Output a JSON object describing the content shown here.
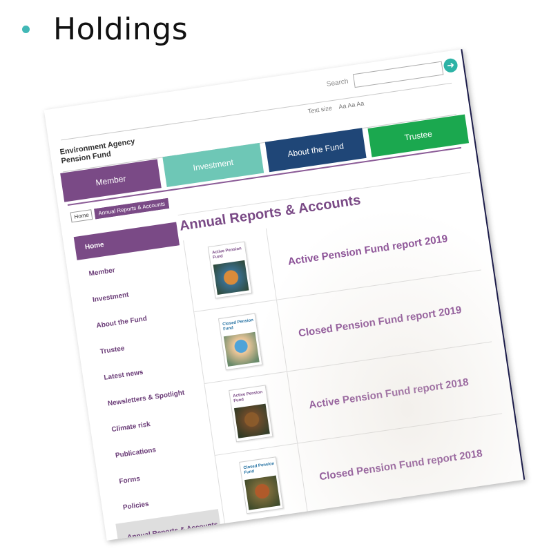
{
  "slide": {
    "title": "Holdings"
  },
  "header": {
    "org_line1": "Environment Agency",
    "org_line2": "Pension Fund",
    "text_size_label": "Text size",
    "text_size_options": "Aa Aa Aa",
    "search_label": "Search",
    "search_value": "",
    "search_go_icon": "➜"
  },
  "nav": {
    "tabs": [
      {
        "label": "Member"
      },
      {
        "label": "Investment"
      },
      {
        "label": "About the Fund"
      },
      {
        "label": "Trustee"
      }
    ]
  },
  "breadcrumb": {
    "home": "Home",
    "current": "Annual Reports & Accounts"
  },
  "sidebar": {
    "items": [
      {
        "label": "Home"
      },
      {
        "label": "Member"
      },
      {
        "label": "Investment"
      },
      {
        "label": "About the Fund"
      },
      {
        "label": "Trustee"
      },
      {
        "label": "Latest news"
      },
      {
        "label": "Newsletters & Spotlight"
      },
      {
        "label": "Climate risk"
      },
      {
        "label": "Publications"
      },
      {
        "label": "Forms"
      },
      {
        "label": "Policies"
      },
      {
        "label": "Annual Reports & Accounts"
      }
    ]
  },
  "main": {
    "title": "Annual Reports & Accounts",
    "reports": [
      {
        "title": "Active Pension Fund report 2019",
        "thumb_title": "Active Pension Fund"
      },
      {
        "title": "Closed Pension Fund report 2019",
        "thumb_title": "Closed Pension Fund"
      },
      {
        "title": "Active Pension Fund report 2018",
        "thumb_title": "Active Pension Fund"
      },
      {
        "title": "Closed Pension Fund report 2018",
        "thumb_title": "Closed Pension Fund"
      }
    ]
  },
  "colors": {
    "member": "#7a4a86",
    "investment": "#6ec7b6",
    "about": "#1f4677",
    "trustee": "#1ba84f",
    "bullet": "#41b8b6"
  }
}
